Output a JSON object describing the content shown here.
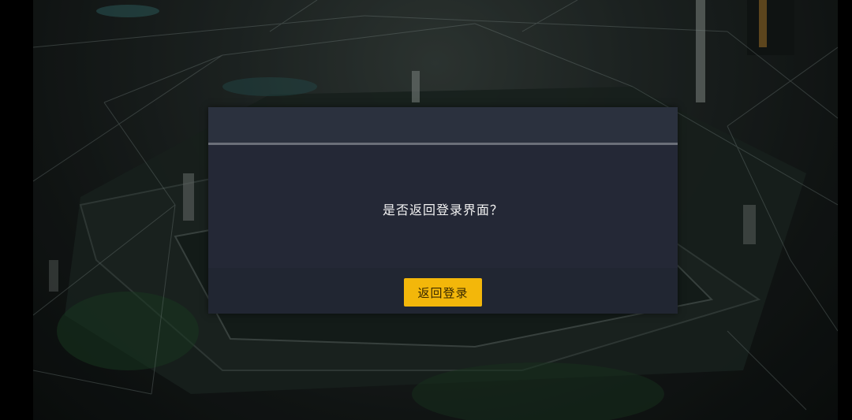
{
  "dialog": {
    "message": "是否返回登录界面？",
    "confirm_label": "返回登录"
  },
  "colors": {
    "button_accent": "#f3b70a",
    "dialog_bg": "#282d3a",
    "text": "#f2f2f2"
  }
}
